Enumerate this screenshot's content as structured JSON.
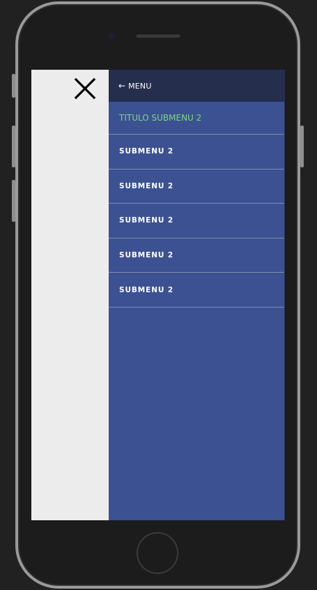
{
  "drawer": {
    "back_icon": "arrow-left-icon",
    "back_glyph": "←",
    "header_label": "MENU",
    "submenu_title": "TITULO SUBMENU 2",
    "items": [
      {
        "label": "SUBMENU 2"
      },
      {
        "label": "SUBMENU 2"
      },
      {
        "label": "SUBMENU 2"
      },
      {
        "label": "SUBMENU 2"
      },
      {
        "label": "SUBMENU 2"
      }
    ]
  },
  "overlay": {
    "close_icon": "close-icon"
  },
  "colors": {
    "drawer_bg": "#3c5192",
    "header_bg": "#262e4d",
    "title_text": "#7fd38b",
    "overlay_bg": "#ececec",
    "device_frame": "#9a9a9a",
    "background": "#212121"
  }
}
